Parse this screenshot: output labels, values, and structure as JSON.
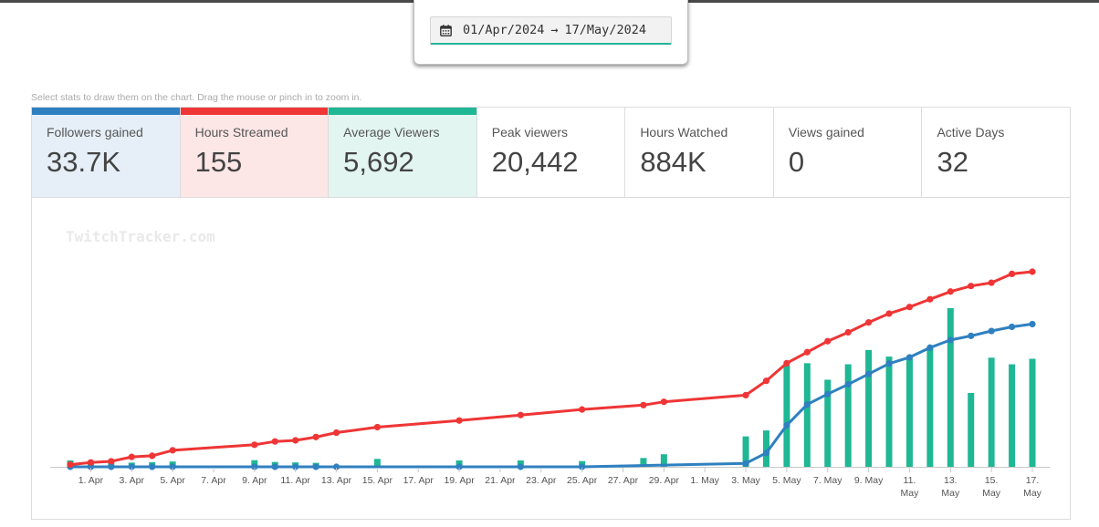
{
  "date_range": {
    "start": "01/Apr/2024",
    "arrow": "→",
    "end": "17/May/2024",
    "icon": "calendar-icon"
  },
  "hint": "Select stats to draw them on the chart. Drag the mouse or pinch in to zoom in.",
  "stats": [
    {
      "label": "Followers gained",
      "value": "33.7K",
      "active": true,
      "color": "#2f80c0",
      "bg": "#e6eff7"
    },
    {
      "label": "Hours Streamed",
      "value": "155",
      "active": true,
      "color": "#ef3535",
      "bg": "#fde6e6"
    },
    {
      "label": "Average Viewers",
      "value": "5,692",
      "active": true,
      "color": "#1fb794",
      "bg": "#e2f5f0"
    },
    {
      "label": "Peak viewers",
      "value": "20,442",
      "active": false
    },
    {
      "label": "Hours Watched",
      "value": "884K",
      "active": false
    },
    {
      "label": "Views gained",
      "value": "0",
      "active": false
    },
    {
      "label": "Active Days",
      "value": "32",
      "active": false
    }
  ],
  "chart_data": {
    "type": "bar+line",
    "watermark": "TwitchTracker.com",
    "x_range": [
      0,
      47
    ],
    "ticks": [
      {
        "pos": 1,
        "label": "1. Apr"
      },
      {
        "pos": 3,
        "label": "3. Apr"
      },
      {
        "pos": 5,
        "label": "5. Apr"
      },
      {
        "pos": 7,
        "label": "7. Apr"
      },
      {
        "pos": 9,
        "label": "9. Apr"
      },
      {
        "pos": 11,
        "label": "11. Apr"
      },
      {
        "pos": 13,
        "label": "13. Apr"
      },
      {
        "pos": 15,
        "label": "15. Apr"
      },
      {
        "pos": 17,
        "label": "17. Apr"
      },
      {
        "pos": 19,
        "label": "19. Apr"
      },
      {
        "pos": 21,
        "label": "21. Apr"
      },
      {
        "pos": 23,
        "label": "23. Apr"
      },
      {
        "pos": 25,
        "label": "25. Apr"
      },
      {
        "pos": 27,
        "label": "27. Apr"
      },
      {
        "pos": 29,
        "label": "29. Apr"
      },
      {
        "pos": 31,
        "label": "1. May"
      },
      {
        "pos": 33,
        "label": "3. May"
      },
      {
        "pos": 35,
        "label": "5. May"
      },
      {
        "pos": 37,
        "label": "7. May"
      },
      {
        "pos": 39,
        "label": "9. May"
      },
      {
        "pos": 41,
        "label": "11.",
        "label2": "May"
      },
      {
        "pos": 43,
        "label": "13.",
        "label2": "May"
      },
      {
        "pos": 45,
        "label": "15.",
        "label2": "May"
      },
      {
        "pos": 47,
        "label": "17.",
        "label2": "May"
      }
    ],
    "series": [
      {
        "name": "Average Viewers",
        "kind": "bar",
        "color": "#1fb794",
        "ylim": [
          0,
          11000
        ],
        "points": [
          [
            0,
            290
          ],
          [
            1,
            250
          ],
          [
            2,
            200
          ],
          [
            3,
            190
          ],
          [
            4,
            210
          ],
          [
            5,
            240
          ],
          [
            9,
            300
          ],
          [
            10,
            220
          ],
          [
            11,
            200
          ],
          [
            12,
            180
          ],
          [
            15,
            360
          ],
          [
            19,
            290
          ],
          [
            22,
            290
          ],
          [
            25,
            260
          ],
          [
            28,
            400
          ],
          [
            29,
            570
          ],
          [
            33,
            1380
          ],
          [
            34,
            1650
          ],
          [
            35,
            4600
          ],
          [
            36,
            4700
          ],
          [
            37,
            3950
          ],
          [
            38,
            4650
          ],
          [
            39,
            5300
          ],
          [
            40,
            5000
          ],
          [
            41,
            4900
          ],
          [
            42,
            5400
          ],
          [
            43,
            7200
          ],
          [
            44,
            3350
          ],
          [
            45,
            4950
          ],
          [
            46,
            4650
          ],
          [
            47,
            4900
          ]
        ]
      },
      {
        "name": "Followers gained",
        "kind": "line",
        "color": "#2f80c0",
        "ylim": [
          0,
          35000
        ],
        "points": [
          [
            0,
            0
          ],
          [
            1,
            0
          ],
          [
            2,
            0
          ],
          [
            3,
            0
          ],
          [
            4,
            0
          ],
          [
            5,
            0
          ],
          [
            9,
            0
          ],
          [
            10,
            0
          ],
          [
            11,
            0
          ],
          [
            12,
            0
          ],
          [
            13,
            0
          ],
          [
            19,
            0
          ],
          [
            22,
            0
          ],
          [
            25,
            0
          ],
          [
            33,
            500
          ],
          [
            34,
            2000
          ],
          [
            35,
            6000
          ],
          [
            36,
            9000
          ],
          [
            37,
            10500
          ],
          [
            38,
            11900
          ],
          [
            39,
            13400
          ],
          [
            40,
            14900
          ],
          [
            41,
            15800
          ],
          [
            42,
            17200
          ],
          [
            43,
            18300
          ],
          [
            44,
            18900
          ],
          [
            45,
            19600
          ],
          [
            46,
            20200
          ],
          [
            47,
            20600
          ]
        ]
      },
      {
        "name": "Hours Streamed",
        "kind": "line",
        "color": "#ef3535",
        "ylim": [
          0,
          220
        ],
        "points": [
          [
            0,
            2
          ],
          [
            1,
            4
          ],
          [
            2,
            5
          ],
          [
            3,
            9
          ],
          [
            4,
            10
          ],
          [
            5,
            15
          ],
          [
            9,
            20
          ],
          [
            10,
            23
          ],
          [
            11,
            24
          ],
          [
            12,
            27
          ],
          [
            13,
            31
          ],
          [
            15,
            36
          ],
          [
            19,
            42
          ],
          [
            22,
            47
          ],
          [
            25,
            52
          ],
          [
            28,
            56
          ],
          [
            29,
            59
          ],
          [
            33,
            65
          ],
          [
            34,
            78
          ],
          [
            35,
            94
          ],
          [
            36,
            104
          ],
          [
            37,
            114
          ],
          [
            38,
            122
          ],
          [
            39,
            131
          ],
          [
            40,
            139
          ],
          [
            41,
            145
          ],
          [
            42,
            152
          ],
          [
            43,
            159
          ],
          [
            44,
            164
          ],
          [
            45,
            167
          ],
          [
            46,
            175
          ],
          [
            47,
            177
          ]
        ]
      }
    ]
  }
}
